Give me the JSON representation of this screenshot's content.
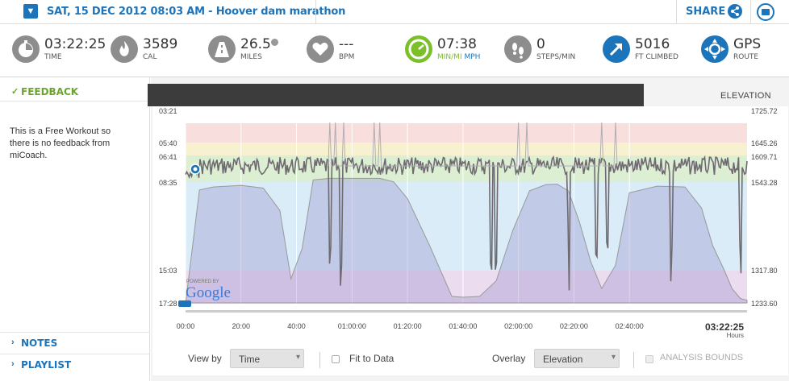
{
  "header": {
    "workout_title": "SAT, 15 DEC 2012 08:03 AM - Hoover dam marathon",
    "share_label": "SHARE"
  },
  "stats": [
    {
      "icon": "stopwatch-icon",
      "value": "03:22:25",
      "label": "TIME"
    },
    {
      "icon": "flame-icon",
      "value": "3589",
      "label": "CAL"
    },
    {
      "icon": "road-icon",
      "value": "26.5",
      "label": "MILES"
    },
    {
      "icon": "heart-icon",
      "value": "---",
      "label": "BPM"
    },
    {
      "icon": "speedometer-icon",
      "value": "07:38",
      "label_a": "MIN/MI",
      "label_b": "MPH"
    },
    {
      "icon": "footprints-icon",
      "value": "0",
      "label": "STEPS/MIN"
    },
    {
      "icon": "climb-arrow-icon",
      "value": "5016",
      "label": "FT CLIMBED"
    },
    {
      "icon": "gps-icon",
      "value": "GPS",
      "label": "ROUTE"
    }
  ],
  "sidebar": {
    "feedback_title": "FEEDBACK",
    "feedback_text": "This is a Free Workout so there is no feedback from miCoach.",
    "notes_label": "NOTES",
    "playlist_label": "PLAYLIST"
  },
  "chart": {
    "panel_label": "ELEVATION",
    "elapsed_total": "03:22:25",
    "elapsed_unit": "Hours",
    "powered_by": "POWERED BY",
    "google_logo": "Google"
  },
  "controls": {
    "view_by_label": "View by",
    "view_by_value": "Time",
    "fit_label": "Fit to Data",
    "overlay_label": "Overlay",
    "overlay_value": "Elevation",
    "analysis_label": "ANALYSIS BOUNDS"
  },
  "colors": {
    "accent": "#1c74bb",
    "green": "#6aa62a",
    "zone_red": "#f9dede",
    "zone_yellow": "#f8f1d0",
    "zone_green": "#dcefd3",
    "zone_blue": "#d9ecf8",
    "zone_purple": "#ecdcf0"
  },
  "chart_data": {
    "type": "line",
    "x_ticks": [
      "00:00",
      "20:00",
      "40:00",
      "01:00:00",
      "01:20:00",
      "01:40:00",
      "02:00:00",
      "02:20:00",
      "02:40:00"
    ],
    "pace_ticks": [
      "03:21",
      "05:40",
      "06:41",
      "08:35",
      "15:03",
      "17:28"
    ],
    "elevation_ticks": [
      "1725.72",
      "1645.26",
      "1609.71",
      "1543.28",
      "1317.80",
      "1233.60"
    ],
    "elevation_profile": {
      "x_minutes": [
        0,
        5,
        10,
        20,
        28,
        34,
        38,
        42,
        46,
        52,
        58,
        64,
        70,
        75,
        80,
        88,
        96,
        100,
        106,
        112,
        118,
        124,
        130,
        134,
        138,
        142,
        146,
        150,
        155,
        160,
        170,
        180,
        186,
        190,
        194,
        197,
        200,
        202.4
      ],
      "y_feet": [
        1232,
        1522,
        1530,
        1534,
        1527,
        1470,
        1295,
        1372,
        1548,
        1552,
        1552,
        1552,
        1552,
        1543,
        1500,
        1380,
        1250,
        1248,
        1250,
        1290,
        1420,
        1520,
        1536,
        1537,
        1520,
        1440,
        1340,
        1270,
        1330,
        1515,
        1532,
        1530,
        1476,
        1380,
        1320,
        1270,
        1245,
        1240
      ]
    }
  }
}
